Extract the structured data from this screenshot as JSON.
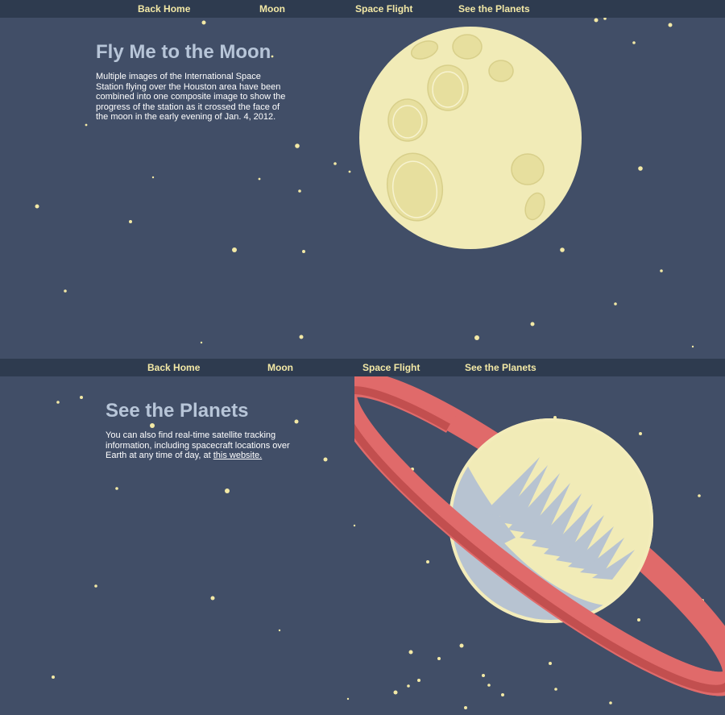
{
  "sections": [
    {
      "nav": [
        "Back Home",
        "Moon",
        "Space Flight",
        "See the Planets"
      ],
      "title": "Fly Me to the Moon",
      "text": "Multiple images of the International Space Station flying over the Houston area have been combined into one composite image to show the progress of the station as it crossed the face of the moon in the early evening of Jan. 4, 2012."
    },
    {
      "nav": [
        "Back Home",
        "Moon",
        "Space Flight",
        "See the Planets"
      ],
      "title": "See the Planets",
      "text_before": "You can also find real-time satellite tracking information, including spacecraft locations over Earth at any time of day, at ",
      "link": "this website."
    }
  ],
  "colors": {
    "background": "#414e67",
    "navbar": "#2e3b4f",
    "nav_text": "#f3e9a6",
    "title": "#b7c5d8",
    "moon": "#f1ebb7",
    "ring": "#d45a5a"
  },
  "illustrations": [
    "moon-illustration",
    "saturn-illustration"
  ]
}
